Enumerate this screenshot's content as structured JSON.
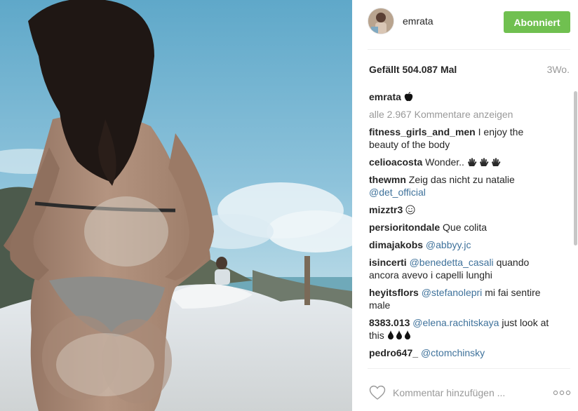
{
  "post": {
    "username": "emrata",
    "follow_label": "Abonniert",
    "likes_text": "Gefällt 504.087 Mal",
    "time_ago": "3Wo.",
    "caption_user": "emrata",
    "caption_icon": "apple-emoji",
    "view_all_comments": "alle 2.967 Kommentare anzeigen"
  },
  "comments": [
    {
      "user": "fitness_girls_and_men",
      "pre": "I enjoy the beauty of the body",
      "mention": "",
      "post": "",
      "icon": ""
    },
    {
      "user": "celioacosta",
      "pre": "Wonder..",
      "mention": "",
      "post": "",
      "icon": "waving-hand-emoji x3"
    },
    {
      "user": "thewmn",
      "pre": "Zeig das nicht zu natalie",
      "mention": "@det_official",
      "post": "",
      "icon": ""
    },
    {
      "user": "mizztr3",
      "pre": "",
      "mention": "",
      "post": "",
      "icon": "smiley-emoji"
    },
    {
      "user": "persioritondale",
      "pre": "Que colita",
      "mention": "",
      "post": "",
      "icon": ""
    },
    {
      "user": "dimajakobs",
      "pre": "",
      "mention": "@abbyy.jc",
      "post": "",
      "icon": ""
    },
    {
      "user": "isincerti",
      "pre": "",
      "mention": "@benedetta_casali",
      "post": "quando ancora avevo i capelli lunghi",
      "icon": ""
    },
    {
      "user": "heyitsflors",
      "pre": "",
      "mention": "@stefanolepri",
      "post": "mi fai sentire male",
      "icon": ""
    },
    {
      "user": "8383.013",
      "pre": "",
      "mention": "@elena.rachitskaya",
      "post": "just look at this",
      "icon": "drop-emoji x3"
    },
    {
      "user": "pedro647_",
      "pre": "",
      "mention": "@ctomchinsky",
      "post": "",
      "icon": ""
    }
  ],
  "footer": {
    "comment_placeholder": "Kommentar hinzufügen ...",
    "heart_icon": "heart-outline-icon",
    "more_icon": "more-horizontal-icon"
  },
  "colors": {
    "follow_button": "#70c050",
    "mention": "#3f729b",
    "muted": "#999999",
    "text": "#262626"
  }
}
